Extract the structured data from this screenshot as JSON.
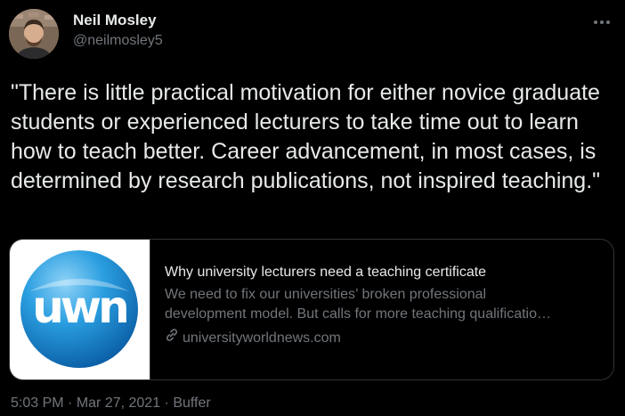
{
  "author": {
    "name": "Neil Mosley",
    "handle": "@neilmosley5"
  },
  "tweet": {
    "text": "\"There is little practical motivation for either novice graduate students or experienced lecturers to take time out to learn how to teach better. Career advancement, in most cases, is determined by research publications, not inspired teaching.\""
  },
  "card": {
    "logo_text": "uwn",
    "title": "Why university lecturers need a teaching certificate",
    "description_line1": "We need to fix our universities’ broken professional",
    "description_line2": "development model. But calls for more teaching qualificatio…",
    "domain": "universityworldnews.com"
  },
  "meta": {
    "time": "5:03 PM",
    "separator1": " · ",
    "date": "Mar 27, 2021",
    "separator2": " · ",
    "source": "Buffer"
  },
  "icons": {
    "more": "more-dots-icon",
    "link": "link-icon"
  },
  "colors": {
    "background": "#000000",
    "text_primary": "#e7e9ea",
    "text_secondary": "#71767b",
    "border": "#2f3336",
    "logo_blue": "#1a8fd6"
  }
}
